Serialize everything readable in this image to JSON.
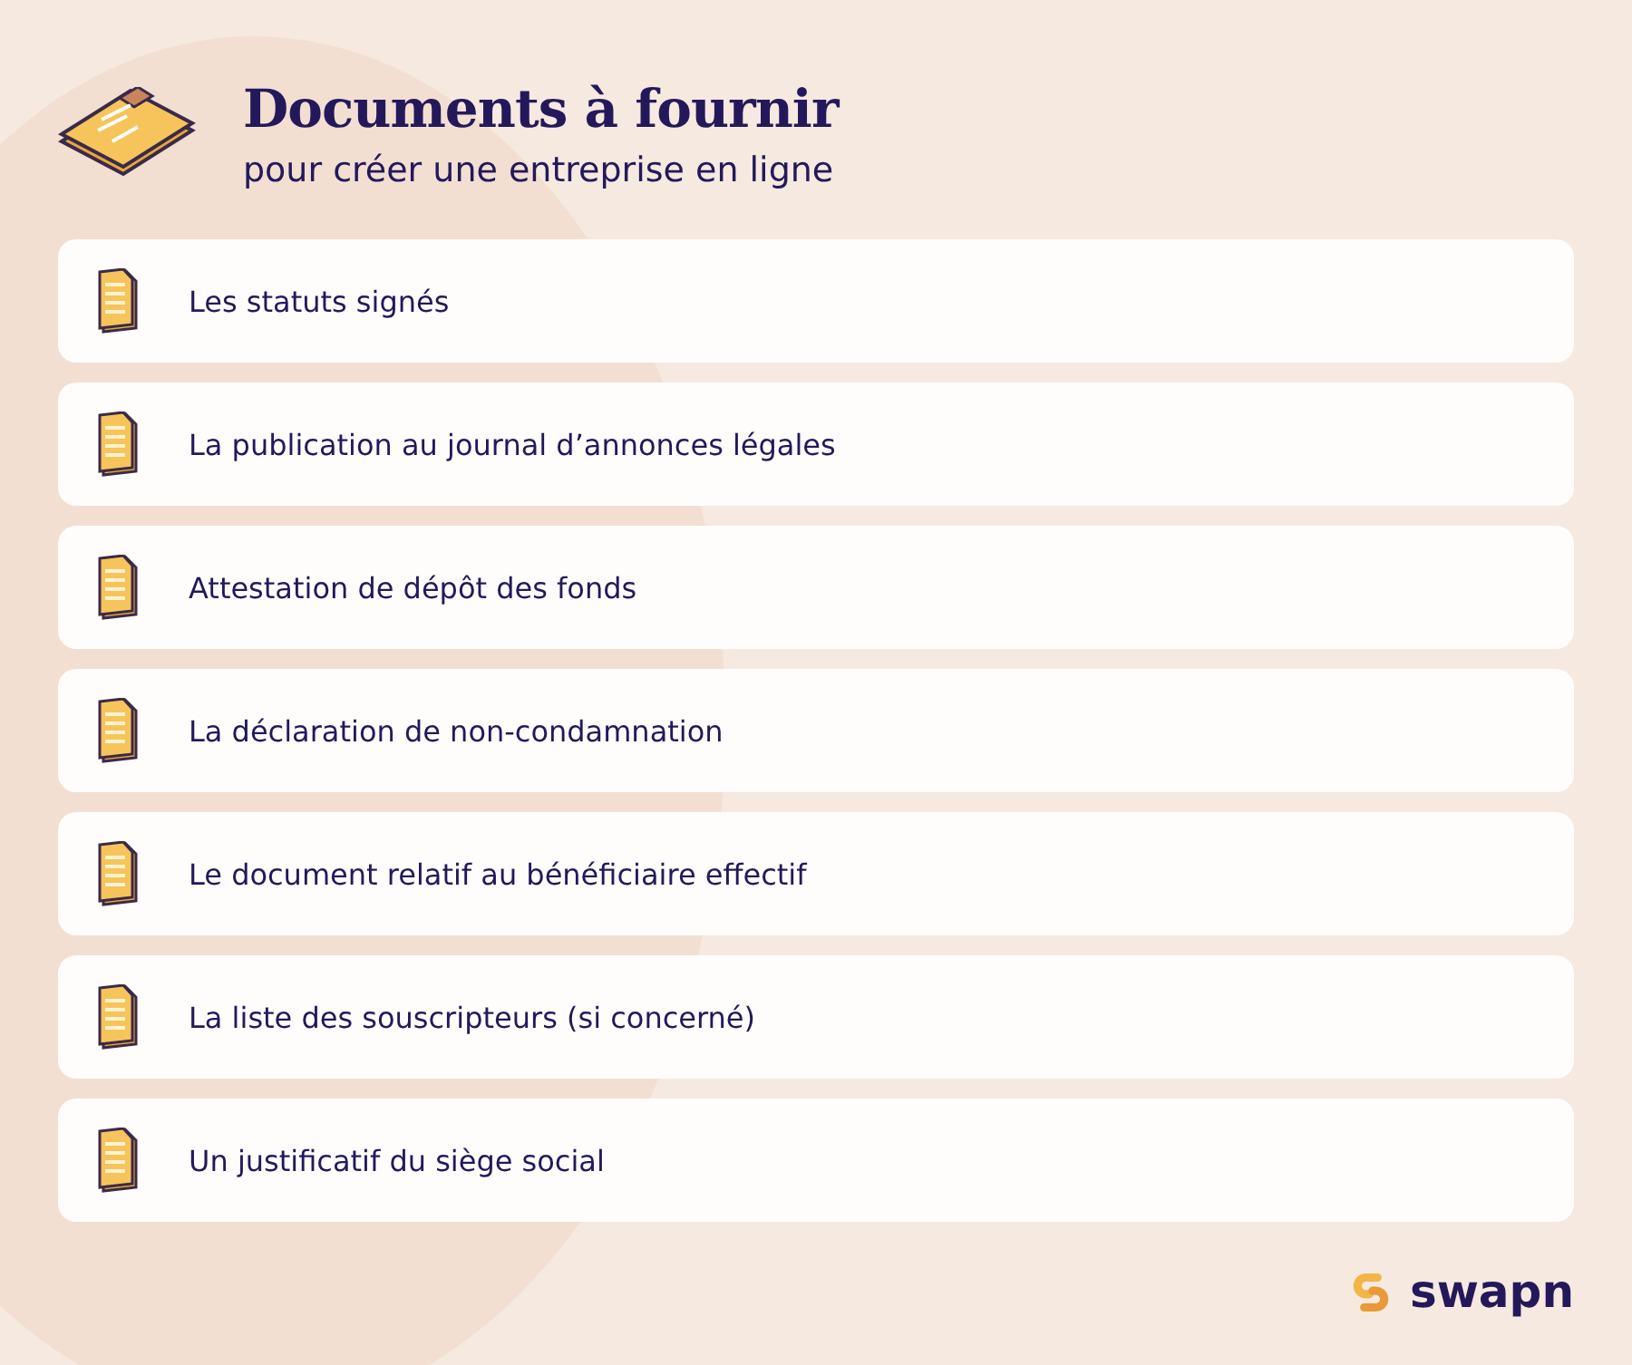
{
  "header": {
    "title": "Documents à fournir",
    "subtitle": "pour créer une entreprise en ligne"
  },
  "documents": [
    {
      "label": "Les statuts signés"
    },
    {
      "label": "La publication au journal d’annonces légales"
    },
    {
      "label": "Attestation de dépôt des fonds"
    },
    {
      "label": "La déclaration de non-condamnation"
    },
    {
      "label": "Le document relatif au bénéficiaire effectif"
    },
    {
      "label": "La liste des souscripteurs (si concerné)"
    },
    {
      "label": "Un justificatif du siège social"
    }
  ],
  "brand": {
    "name": "swapn"
  }
}
